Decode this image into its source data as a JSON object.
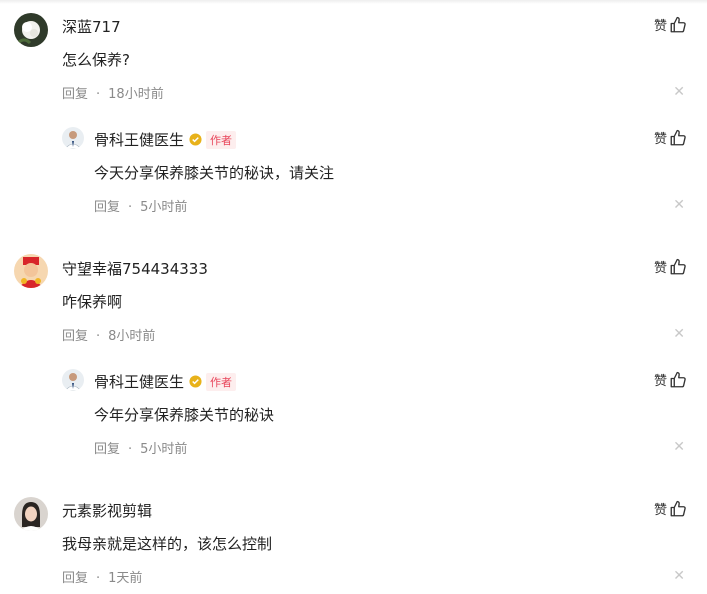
{
  "common": {
    "like_label": "赞",
    "reply_label": "回复",
    "dot": "·",
    "close_glyph": "✕",
    "author_tag": "作者"
  },
  "comments": [
    {
      "name": "深蓝717",
      "text": "怎么保养?",
      "time": "18小时前"
    },
    {
      "name": "骨科王健医生",
      "text": "今天分享保养膝关节的秘诀，请关注",
      "time": "5小时前",
      "is_author": true
    },
    {
      "name": "守望幸福754434333",
      "text": "咋保养啊",
      "time": "8小时前"
    },
    {
      "name": "骨科王健医生",
      "text": "今年分享保养膝关节的秘诀",
      "time": "5小时前",
      "is_author": true
    },
    {
      "name": "元素影视剪辑",
      "text": "我母亲就是这样的，该怎么控制",
      "time": "1天前"
    }
  ],
  "colors": {
    "author_tag": "#e8455a",
    "verified": "#e8b21a",
    "meta": "#8a8a8a"
  }
}
